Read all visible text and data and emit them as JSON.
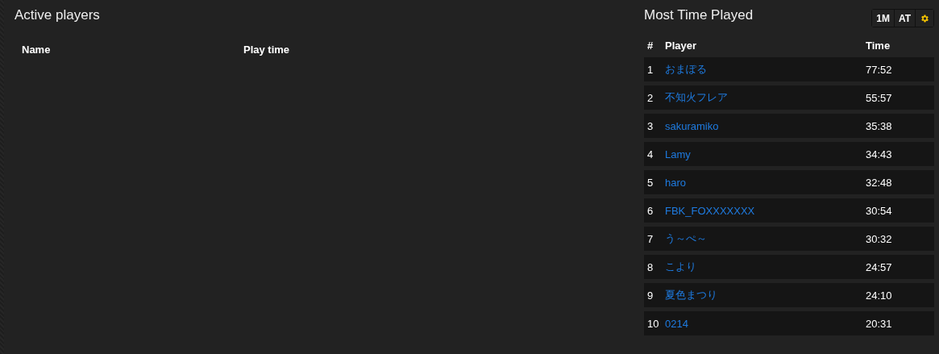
{
  "active_players": {
    "title": "Active players",
    "columns": [
      "Name",
      "Play time"
    ]
  },
  "most_time_played": {
    "title": "Most Time Played",
    "range_buttons": [
      "1M",
      "AT"
    ],
    "columns": [
      "#",
      "Player",
      "Time"
    ],
    "rows": [
      {
        "rank": "1",
        "player": "おまぽる",
        "time": "77:52"
      },
      {
        "rank": "2",
        "player": "不知火フレア",
        "time": "55:57"
      },
      {
        "rank": "3",
        "player": "sakuramiko",
        "time": "35:38"
      },
      {
        "rank": "4",
        "player": "Lamy",
        "time": "34:43"
      },
      {
        "rank": "5",
        "player": "haro",
        "time": "32:48"
      },
      {
        "rank": "6",
        "player": "FBK_FOXXXXXXX",
        "time": "30:54"
      },
      {
        "rank": "7",
        "player": "う～ぺ～",
        "time": "30:32"
      },
      {
        "rank": "8",
        "player": "こより",
        "time": "24:57"
      },
      {
        "rank": "9",
        "player": "夏色まつり",
        "time": "24:10"
      },
      {
        "rank": "10",
        "player": "0214",
        "time": "20:31"
      }
    ]
  }
}
